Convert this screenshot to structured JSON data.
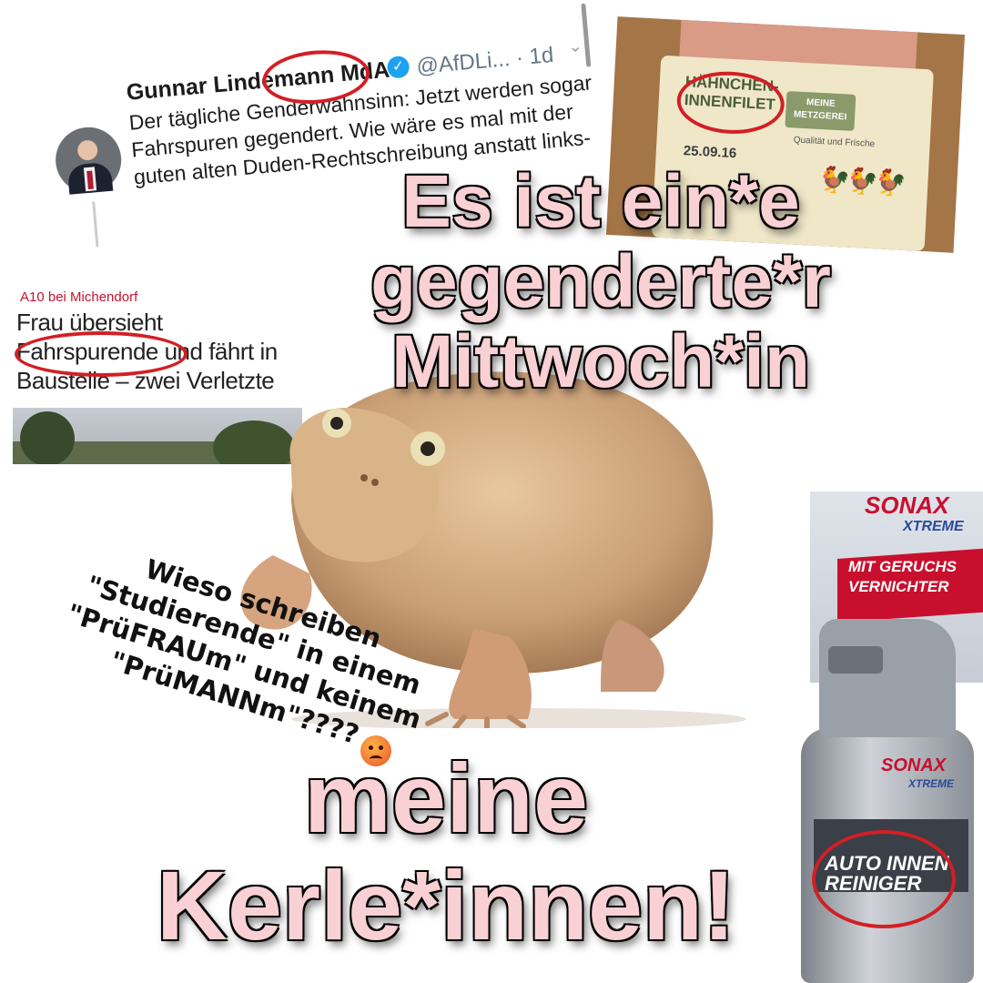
{
  "tweet": {
    "author": "Gunnar Lindemann MdA",
    "handle": "@AfDLi... · 1d",
    "text": "Der tägliche Genderwahnsinn: Jetzt werden sogar Fahrspuren gegendert. Wie wäre es mal mit der guten alten Duden-Rechtschreibung anstatt links-"
  },
  "chicken_package": {
    "product": "HÄHNCHEN-INNENFILET",
    "brand_badge": "MEINE METZGEREI",
    "tagline": "Qualität und Frische",
    "date": "25.09.16"
  },
  "news": {
    "kicker": "A10 bei Michendorf",
    "headline": "Frau übersieht Fahrspurende und fährt in Baustelle – zwei Verletzte"
  },
  "captions": {
    "top_line1": "Es ist ein*e",
    "top_line2": "gegenderte*r",
    "top_line3": "Mittwoch*in",
    "bottom_line1": "meine",
    "bottom_line2": "Kerle*innen!"
  },
  "question": {
    "line1": "Wieso schreiben",
    "line2": "\"Studierende\" in einem",
    "line3": "\"PrüFRAUm\" und keinem",
    "line4": "\"PrüMANNm\"????"
  },
  "sonax_top": {
    "brand": "SONAX",
    "line": "XTREME",
    "feature": "MIT GERUCHS VERNICHTER"
  },
  "sonax_bottom": {
    "brand": "SONAX",
    "line": "XTREME",
    "product": "AUTO INNEN REINIGER"
  },
  "colors": {
    "caption_fill": "#f9d0d3",
    "highlight_circle": "#d21f25",
    "sonax_red": "#c8102e",
    "verified_blue": "#1da1f2"
  },
  "icons": [
    "verified-badge-icon",
    "chevron-down-icon",
    "angry-face-emoji-icon"
  ]
}
